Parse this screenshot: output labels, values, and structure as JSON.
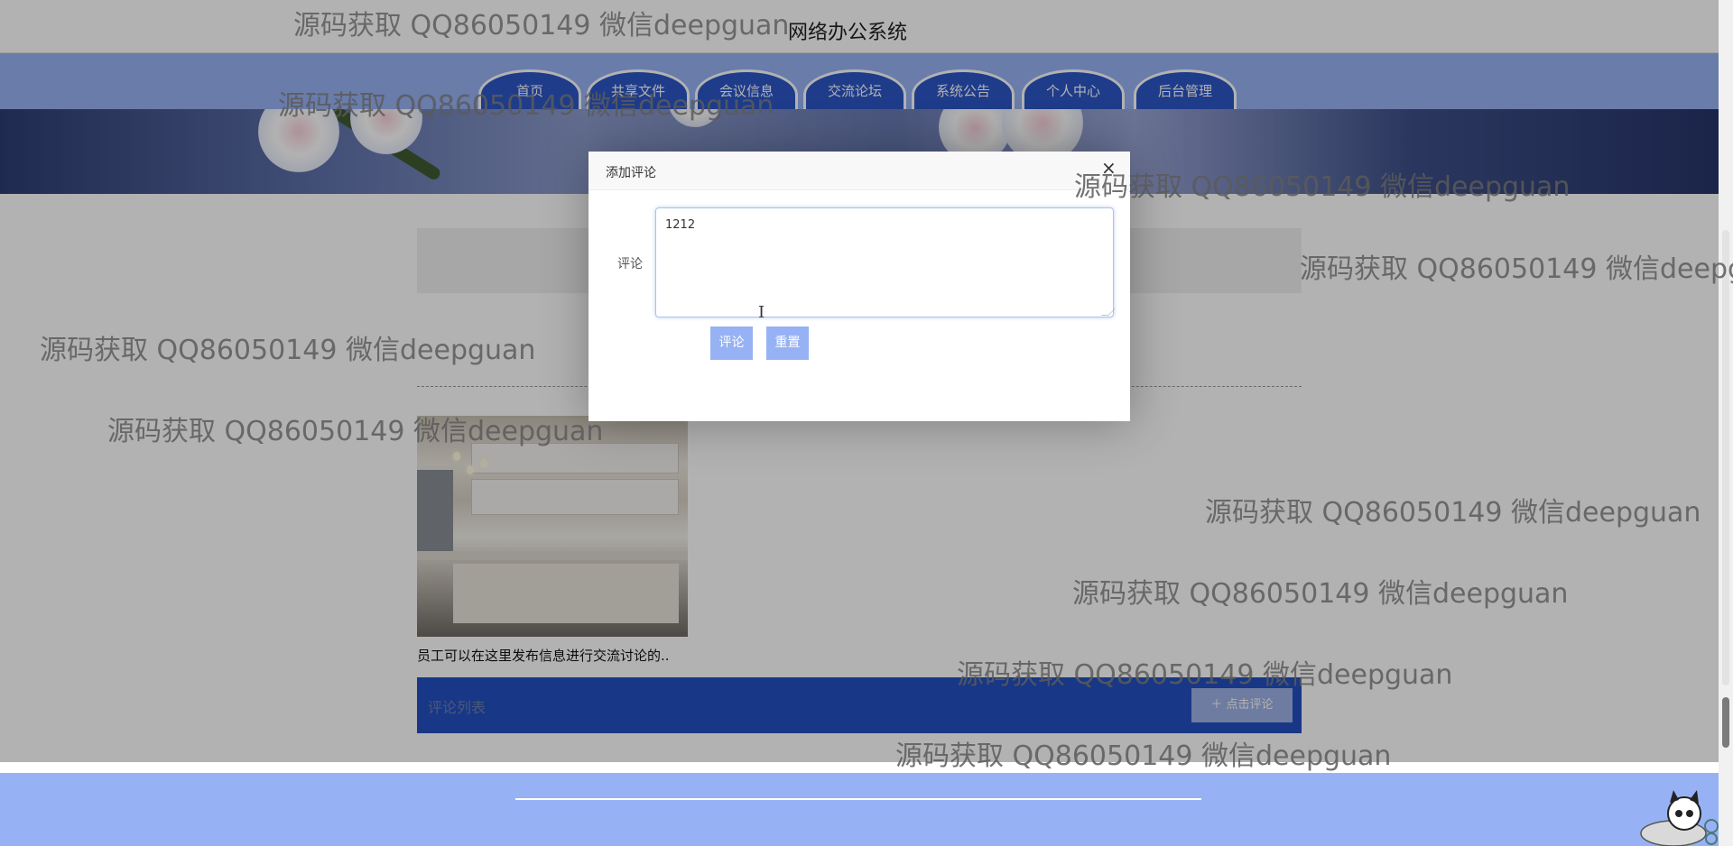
{
  "header": {
    "site_title": "网络办公系统"
  },
  "nav": {
    "items": [
      {
        "label": "首页"
      },
      {
        "label": "共享文件"
      },
      {
        "label": "会议信息"
      },
      {
        "label": "交流论坛"
      },
      {
        "label": "系统公告"
      },
      {
        "label": "个人中心"
      },
      {
        "label": "后台管理"
      }
    ]
  },
  "post": {
    "caption": "员工可以在这里发布信息进行交流讨论的..",
    "comments_list_label": "评论列表",
    "add_comment_label": "＋ 点击评论"
  },
  "modal": {
    "title": "添加评论",
    "close_symbol": "×",
    "field_label": "评论",
    "comment_value": "1212",
    "submit_label": "评论",
    "reset_label": "重置"
  },
  "watermark": {
    "text": "源码获取 QQ86050149 微信deepguan"
  },
  "colors": {
    "nav_bg": "#97b2f4",
    "nav_tab": "#2b56c6",
    "comments_bar": "#2350c0",
    "button": "#97b2f4"
  }
}
